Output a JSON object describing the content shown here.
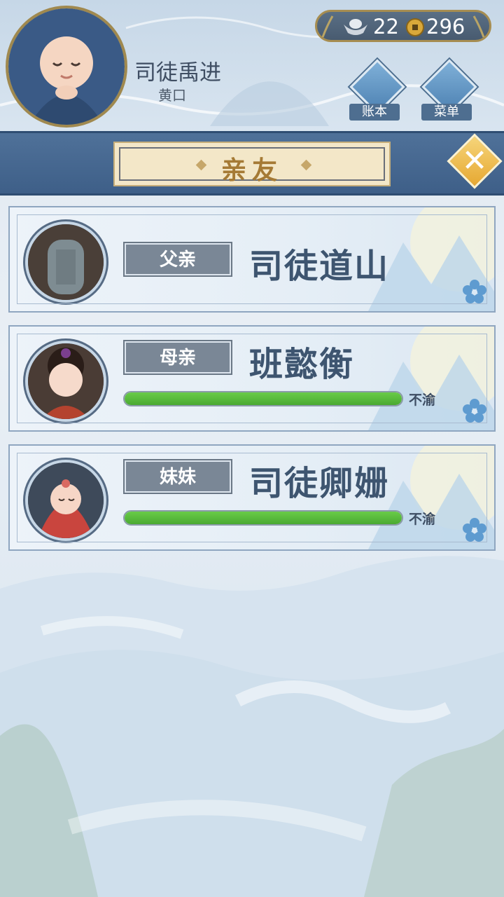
{
  "player": {
    "name": "司徒禹进",
    "title": "黄口"
  },
  "currency": {
    "silver": "22",
    "copper": "296"
  },
  "hud": {
    "ledger_label": "账本",
    "menu_label": "菜单"
  },
  "panel": {
    "title": "亲友"
  },
  "relatives": [
    {
      "relation": "父亲",
      "name": "司徒道山",
      "health_label": "",
      "health": null
    },
    {
      "relation": "母亲",
      "name": "班懿衡",
      "health_label": "不渝",
      "health": 1.0
    },
    {
      "relation": "妹妹",
      "name": "司徒卿姗",
      "health_label": "不渝",
      "health": 1.0
    }
  ],
  "colors": {
    "banner": "#4f7199",
    "accent_gold": "#e6a832",
    "health_green": "#4aa932"
  },
  "icons": [
    "silver-ingot-icon",
    "copper-coin-icon",
    "ledger-icon",
    "menu-dots-icon",
    "close-icon",
    "flower-icon"
  ]
}
